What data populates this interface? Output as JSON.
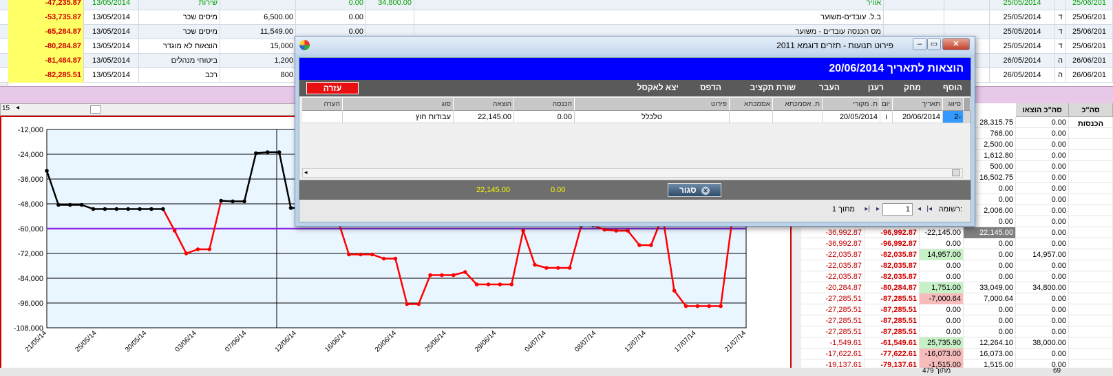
{
  "top_rows": [
    {
      "bal": "-47,235.87",
      "date": "13/05/2014",
      "type": "שירות",
      "amt": "",
      "zero": "0.00",
      "val": "34,800.00",
      "desc": "אוויר",
      "d1": "25/05/2014",
      "dl": "",
      "d2": "25/06/201"
    },
    {
      "bal": "-53,735.87",
      "date": "13/05/2014",
      "type": "מיסים שכר",
      "amt": "6,500.00",
      "zero": "0.00",
      "val": "",
      "desc": "ב.ל. עובדים-משוער",
      "d1": "25/05/2014",
      "dl": "ד",
      "d2": "25/06/201"
    },
    {
      "bal": "-65,284.87",
      "date": "13/05/2014",
      "type": "מיסים שכר",
      "amt": "11,549.00",
      "zero": "0.00",
      "val": "",
      "desc": "מס הכנסה עובדים - משוער",
      "d1": "25/05/2014",
      "dl": "ד",
      "d2": "25/06/201"
    },
    {
      "bal": "-80,284.87",
      "date": "13/05/2014",
      "type": "הוצאות לא מוגדר",
      "amt": "15,000",
      "zero": "",
      "val": "",
      "desc": "",
      "d1": "25/05/2014",
      "dl": "ד",
      "d2": "25/06/201"
    },
    {
      "bal": "-81,484.87",
      "date": "13/05/2014",
      "type": "ביטוחי מנהלים",
      "amt": "1,200",
      "zero": "",
      "val": "",
      "desc": "",
      "d1": "26/05/2014",
      "dl": "ה",
      "d2": "26/06/201"
    },
    {
      "bal": "-82,285.51",
      "date": "13/05/2014",
      "type": "רכב",
      "amt": "800",
      "zero": "",
      "val": "",
      "desc": "",
      "d1": "26/05/2014",
      "dl": "ה",
      "d2": "26/06/201"
    }
  ],
  "hscroll_num": "15",
  "right_grid": {
    "headers": [
      "סה\"כ הכנסות",
      "סה\"כ הוצאו"
    ],
    "rows": [
      {
        "c1": "",
        "c2": "",
        "c3": "",
        "c4": "28,315.75",
        "c5": "0.00",
        "c6": ""
      },
      {
        "c1": "",
        "c2": "",
        "c3": "",
        "c4": "768.00",
        "c5": "0.00",
        "c6": ""
      },
      {
        "c1": "",
        "c2": "",
        "c3": "",
        "c4": "2,500.00",
        "c5": "0.00",
        "c6": ""
      },
      {
        "c1": "",
        "c2": "",
        "c3": "",
        "c4": "1,612.80",
        "c5": "0.00",
        "c6": ""
      },
      {
        "c1": "",
        "c2": "",
        "c3": "",
        "c4": "500.00",
        "c5": "0.00",
        "c6": ""
      },
      {
        "c1": "",
        "c2": "",
        "c3": "",
        "c4": "16,502.75",
        "c5": "0.00",
        "c6": ""
      },
      {
        "c1": "",
        "c2": "",
        "c3": "",
        "c4": "0.00",
        "c5": "0.00",
        "c6": ""
      },
      {
        "c1": "",
        "c2": "",
        "c3": "",
        "c4": "0.00",
        "c5": "0.00",
        "c6": ""
      },
      {
        "c1": "",
        "c2": "",
        "c3": "",
        "c4": "2,006.00",
        "c5": "0.00",
        "c6": ""
      },
      {
        "c1": "",
        "c2": "",
        "c3": "",
        "c4": "0.00",
        "c5": "0.00",
        "c6": ""
      },
      {
        "c1": "-36,992.87",
        "c2": "-96,992.87",
        "c3": "-22,145.00",
        "c4": "22,145.00",
        "c5": "0.00",
        "c6": "",
        "hl": "gray"
      },
      {
        "c1": "-36,992.87",
        "c2": "-96,992.87",
        "c3": "0.00",
        "c4": "0.00",
        "c5": "0.00",
        "c6": ""
      },
      {
        "c1": "-22,035.87",
        "c2": "-82,035.87",
        "c3": "14,957.00",
        "c4": "0.00",
        "c5": "14,957.00",
        "c6": "",
        "hl": "green"
      },
      {
        "c1": "-22,035.87",
        "c2": "-82,035.87",
        "c3": "0.00",
        "c4": "0.00",
        "c5": "0.00",
        "c6": ""
      },
      {
        "c1": "-22,035.87",
        "c2": "-82,035.87",
        "c3": "0.00",
        "c4": "0.00",
        "c5": "0.00",
        "c6": ""
      },
      {
        "c1": "-20,284.87",
        "c2": "-80,284.87",
        "c3": "1,751.00",
        "c4": "33,049.00",
        "c5": "34,800.00",
        "c6": "",
        "hl": "green"
      },
      {
        "c1": "-27,285.51",
        "c2": "-87,285.51",
        "c3": "-7,000.64",
        "c4": "7,000.64",
        "c5": "0.00",
        "c6": "",
        "hl": "pink"
      },
      {
        "c1": "-27,285.51",
        "c2": "-87,285.51",
        "c3": "0.00",
        "c4": "0.00",
        "c5": "0.00",
        "c6": ""
      },
      {
        "c1": "-27,285.51",
        "c2": "-87,285.51",
        "c3": "0.00",
        "c4": "0.00",
        "c5": "0.00",
        "c6": ""
      },
      {
        "c1": "-27,285.51",
        "c2": "-87,285.51",
        "c3": "0.00",
        "c4": "0.00",
        "c5": "0.00",
        "c6": ""
      },
      {
        "c1": "-1,549.61",
        "c2": "-61,549.61",
        "c3": "25,735.90",
        "c4": "12,264.10",
        "c5": "38,000.00",
        "c6": "",
        "hl": "green"
      },
      {
        "c1": "-17,622.61",
        "c2": "-77,622.61",
        "c3": "-16,073.00",
        "c4": "16,073.00",
        "c5": "0.00",
        "c6": "",
        "hl": "pink"
      },
      {
        "c1": "-19,137.61",
        "c2": "-79,137.61",
        "c3": "-1,515.00",
        "c4": "1,515.00",
        "c5": "0.00",
        "c6": "",
        "hl": "pink"
      }
    ]
  },
  "status": {
    "left": "מתוך 479",
    "right": "69"
  },
  "dialog": {
    "title": "פירוט תנועות - תזרים דוגמא 2011",
    "header": "הוצאות  לתאריך 20/06/2014",
    "toolbar": [
      "הוסף",
      "מחק",
      "רענן",
      "העבר",
      "שורת תקציב",
      "הדפס",
      "יצא לאקסל"
    ],
    "help": "עזרה",
    "columns": [
      "סיווג",
      "תאריך",
      "יום",
      "ת. מקורי",
      "ת. אסמכתא",
      "אסמכתא",
      "פירוט",
      "הכנסה",
      "הוצאה",
      "סוג",
      "הערה"
    ],
    "row": {
      "class": "2-",
      "date": "20/06/2014",
      "day": "ו",
      "orig": "20/05/2014",
      "refdate": "",
      "ref": "",
      "detail": "טלכלל",
      "income": "0.00",
      "expense": "22,145.00",
      "type": "עבודות חוץ",
      "note": ""
    },
    "totals": {
      "expense": "22,145.00",
      "income": "0.00"
    },
    "close": "סגור",
    "nav": {
      "label": "רשומה:",
      "current": "1",
      "of": "מתוך 1"
    }
  },
  "chart_data": {
    "type": "line",
    "y_ticks": [
      "-12,000",
      "-24,000",
      "-36,000",
      "-48,000",
      "-60,000",
      "-72,000",
      "-84,000",
      "-96,000",
      "-108,000"
    ],
    "ylim": [
      -108000,
      -12000
    ],
    "x_ticks": [
      "21/05/14",
      "25/05/14",
      "30/05/14",
      "03/06/14",
      "07/06/14",
      "12/06/14",
      "16/06/14",
      "20/06/14",
      "25/06/14",
      "29/06/14",
      "04/07/14",
      "08/07/14",
      "12/07/14",
      "17/07/14",
      "21/07/14"
    ],
    "threshold": -60000,
    "threshold_color": "#8a2be2",
    "series": [
      {
        "values": [
          -32000,
          -48500,
          -48500,
          -48500,
          -50500,
          -50500,
          -50500,
          -50500,
          -50500,
          -50500,
          -50500,
          -61000,
          -72000,
          -70000,
          -70000,
          -46500,
          -46800,
          -46800,
          -23500,
          -23000,
          -23000,
          -50000,
          -50000,
          -52000,
          -55000,
          -55000,
          -72500,
          -72500,
          -72500,
          -74500,
          -74500,
          -96500,
          -96500,
          -82500,
          -82500,
          -82500,
          -81000,
          -87000,
          -87000,
          -87000,
          -87000,
          -61000,
          -77500,
          -79000,
          -79000,
          -79000,
          -58500,
          -58500,
          -60500,
          -61000,
          -61000,
          -68000,
          -68000,
          -54000,
          -90000,
          -97500,
          -97500,
          -97500,
          -97500,
          -55000
        ]
      }
    ]
  }
}
